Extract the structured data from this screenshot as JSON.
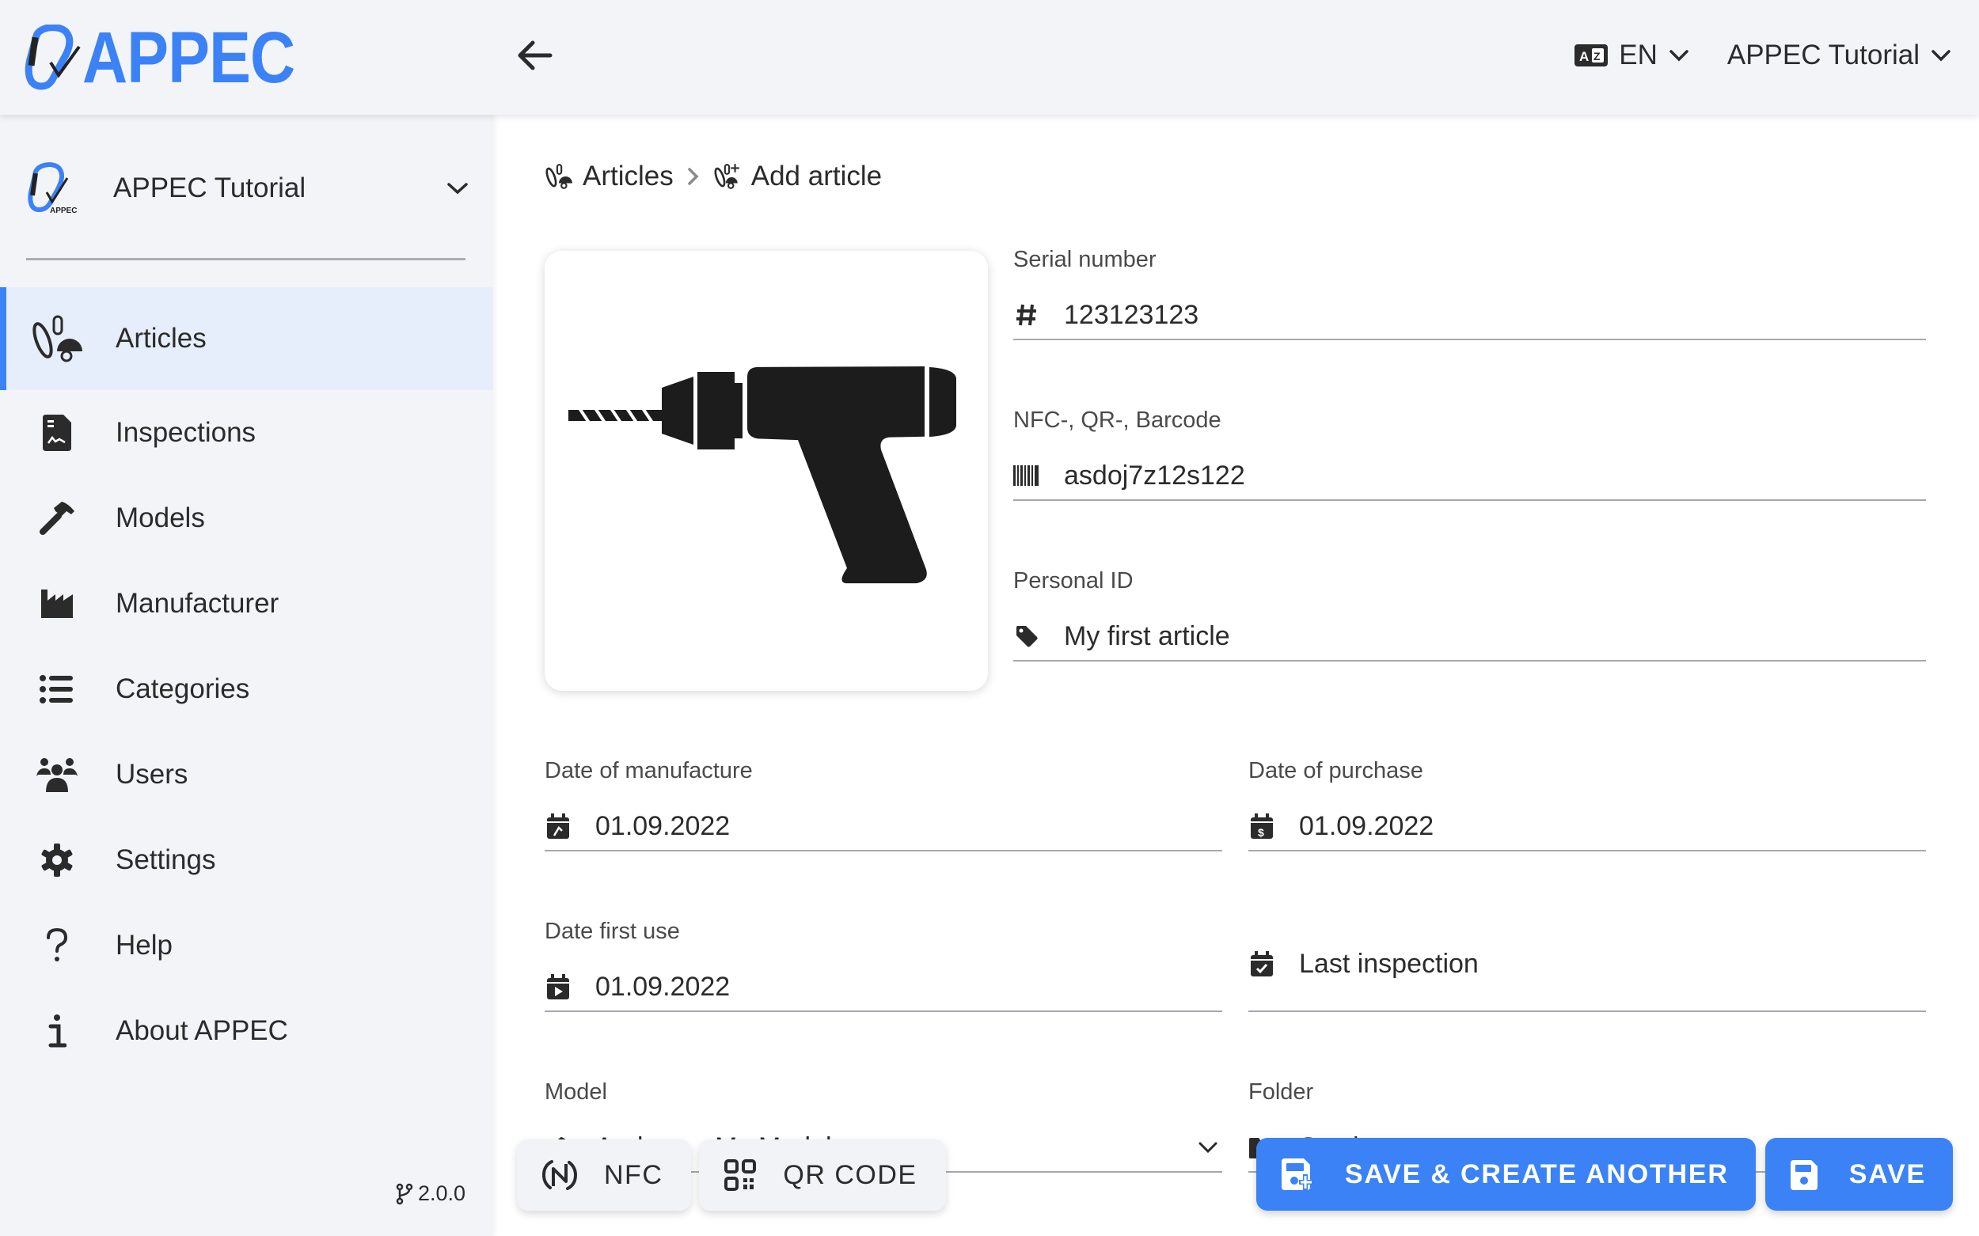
{
  "header": {
    "logo_text": "APPEC",
    "language": "EN",
    "organization": "APPEC Tutorial"
  },
  "sidebar": {
    "org_name": "APPEC Tutorial",
    "items": [
      {
        "label": "Articles",
        "icon": "articles-icon",
        "active": true
      },
      {
        "label": "Inspections",
        "icon": "inspection-document-icon"
      },
      {
        "label": "Models",
        "icon": "hammer-icon"
      },
      {
        "label": "Manufacturer",
        "icon": "factory-icon"
      },
      {
        "label": "Categories",
        "icon": "list-icon"
      },
      {
        "label": "Users",
        "icon": "users-icon"
      },
      {
        "label": "Settings",
        "icon": "gear-icon"
      },
      {
        "label": "Help",
        "icon": "question-icon"
      },
      {
        "label": "About APPEC",
        "icon": "info-icon"
      }
    ],
    "version": "2.0.0"
  },
  "breadcrumb": {
    "parent": "Articles",
    "current": "Add article"
  },
  "form": {
    "image_alt": "drill-icon",
    "serial_number": {
      "label": "Serial number",
      "value": "123123123"
    },
    "code": {
      "label": "NFC-, QR-, Barcode",
      "value": "asdoj7z12s122"
    },
    "personal_id": {
      "label": "Personal ID",
      "value": "My first article"
    },
    "date_manufacture": {
      "label": "Date of manufacture",
      "value": "01.09.2022"
    },
    "date_purchase": {
      "label": "Date of purchase",
      "value": "01.09.2022"
    },
    "date_first_use": {
      "label": "Date first use",
      "value": "01.09.2022"
    },
    "last_inspection": {
      "placeholder": "Last inspection"
    },
    "model": {
      "label": "Model",
      "value": "Andorra - My Model"
    },
    "folder": {
      "label": "Folder",
      "value": "Stock"
    }
  },
  "actions": {
    "nfc": "NFC",
    "qr": "QR CODE",
    "save_create": "SAVE & CREATE ANOTHER",
    "save": "SAVE"
  },
  "colors": {
    "accent": "#3b82f6",
    "sidebar_bg": "#f3f4f8",
    "active_bg": "#e7eefb"
  }
}
